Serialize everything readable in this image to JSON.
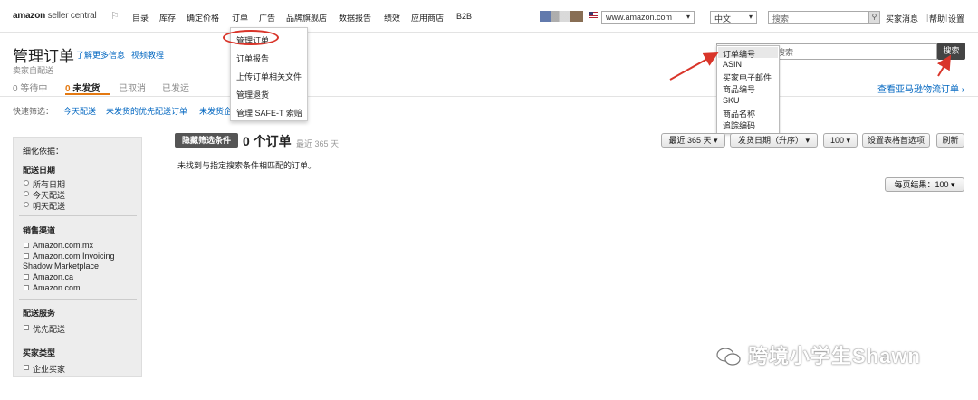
{
  "topnav": {
    "logo_bold": "amazon",
    "logo_light": " seller central",
    "items": [
      "目录",
      "库存",
      "确定价格",
      "订单",
      "广告",
      "品牌旗舰店",
      "数据报告",
      "绩效",
      "应用商店",
      "B2B"
    ],
    "marketplace": "www.amazon.com",
    "language": "中文",
    "search_placeholder": "搜索",
    "links": [
      "买家消息",
      "帮助",
      "设置"
    ]
  },
  "order_menu": {
    "items": [
      "管理订单",
      "订单报告",
      "上传订单相关文件",
      "管理退货",
      "管理 SAFE-T 索赔"
    ]
  },
  "header": {
    "title": "管理订单",
    "learn_more": "了解更多信息",
    "video": "视频教程",
    "seller_fulfilled": "卖家自配送",
    "tabs": [
      {
        "count": "0",
        "label": "等待中"
      },
      {
        "count": "0",
        "label": "未发货"
      },
      {
        "count": "",
        "label": "已取消"
      },
      {
        "count": "",
        "label": "已发运"
      }
    ],
    "quick_filter_label": "快速筛选：",
    "quick_filters": [
      "今天配送",
      "未发货的优先配送订单",
      "未发货企"
    ],
    "fba_link": "查看亚马逊物流订单 ›"
  },
  "search": {
    "placeholder": "搜索",
    "button": "搜索",
    "types": [
      "订单编号",
      "ASIN",
      "买家电子邮件",
      "商品编号",
      "SKU",
      "商品名称",
      "追踪编码"
    ]
  },
  "sidebar": {
    "title": "细化依据：",
    "sections": [
      {
        "heading": "配送日期",
        "type": "radio",
        "options": [
          "所有日期",
          "今天配送",
          "明天配送"
        ]
      },
      {
        "heading": "销售渠道",
        "type": "check",
        "options": [
          "Amazon.com.mx",
          "Amazon.com Invoicing",
          "Shadow Marketplace",
          "Amazon.ca",
          "Amazon.com"
        ]
      },
      {
        "heading": "配送服务",
        "type": "check",
        "options": [
          "优先配送"
        ]
      },
      {
        "heading": "买家类型",
        "type": "check",
        "options": [
          "企业买家"
        ]
      }
    ]
  },
  "main": {
    "hide_filters": "隐藏筛选条件",
    "order_count": "0 个订单",
    "recent_days": "最近 365 天",
    "range_select": "最近 365 天",
    "sort_select": "发货日期（升序）",
    "page_size_select": "100",
    "table_prefs": "设置表格首选项",
    "refresh": "刷新",
    "no_results": "未找到与指定搜索条件相匹配的订单。",
    "per_page": "每页结果：100"
  },
  "watermark": "跨境小学生Shawn",
  "colors": {
    "accent": "#e47911",
    "link": "#0066c0",
    "annotation": "#d9352a"
  }
}
